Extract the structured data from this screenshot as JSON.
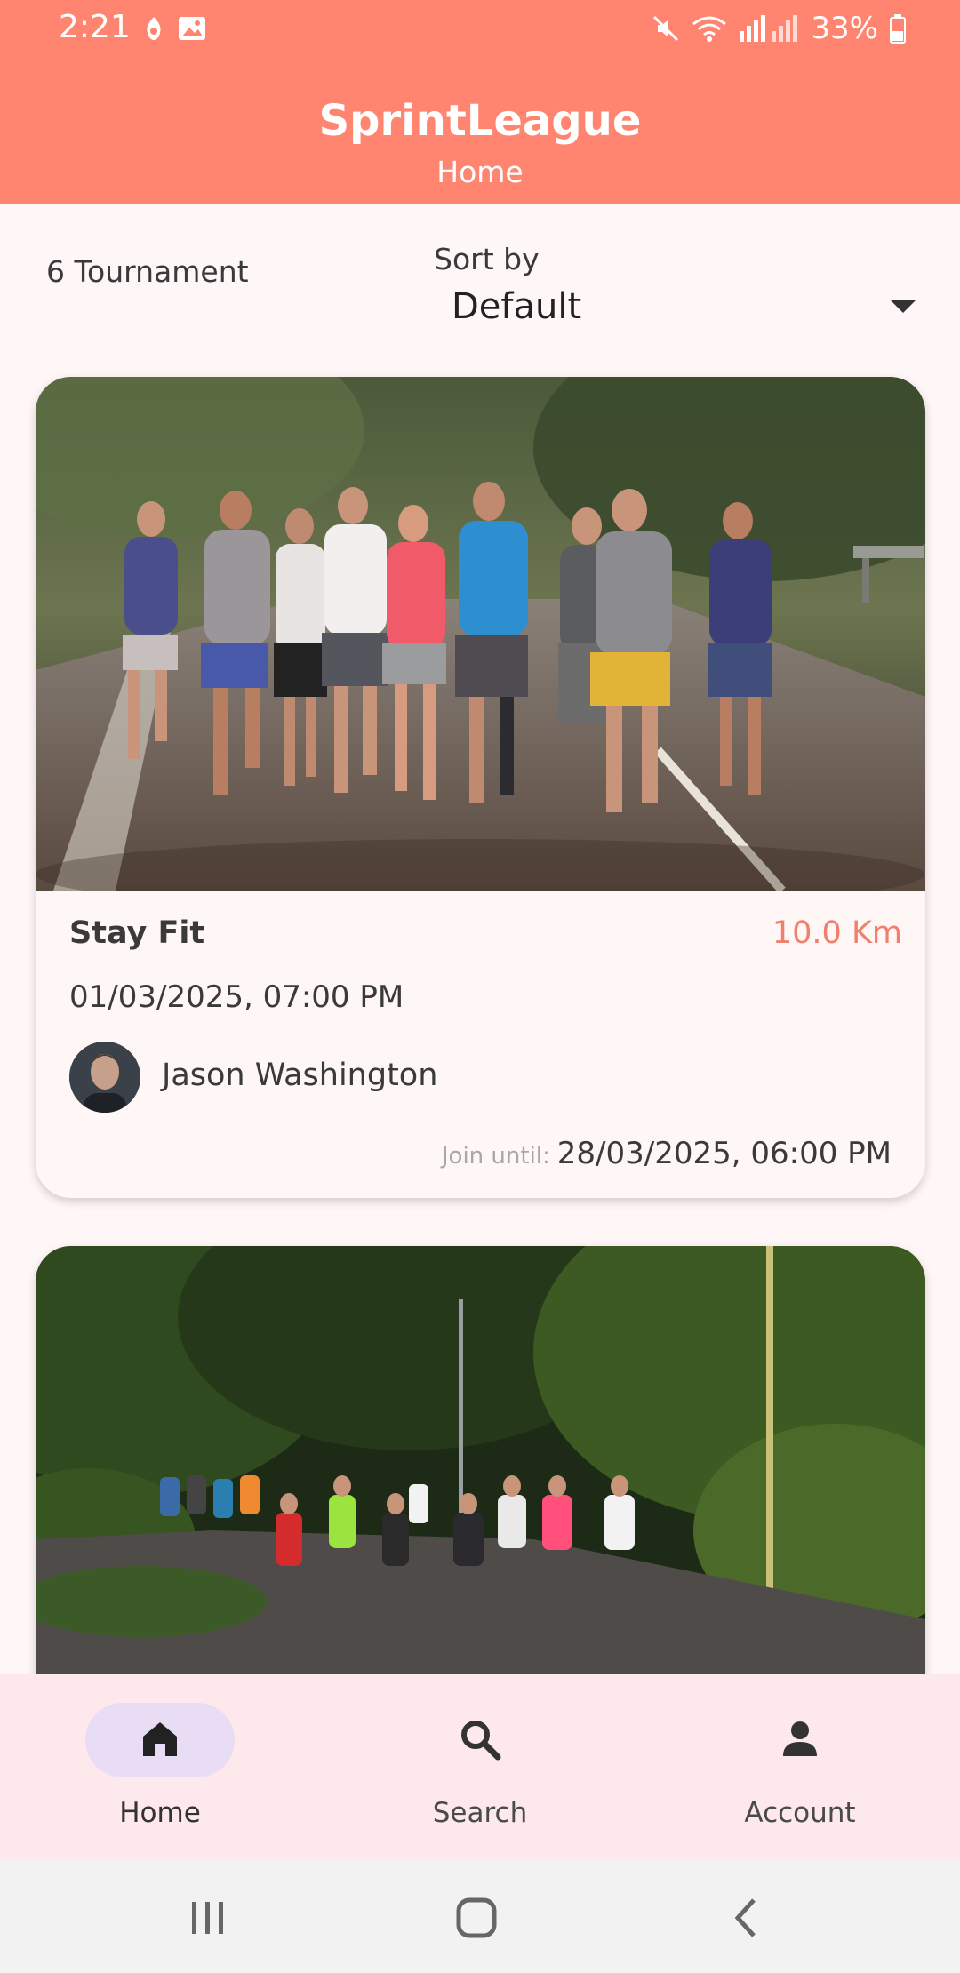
{
  "status_bar": {
    "time": "2:21",
    "battery_text": "33%",
    "icons": [
      "notification-icon",
      "image-icon",
      "mute-icon",
      "wifi-icon",
      "signal-icon",
      "battery-icon"
    ]
  },
  "header": {
    "title": "SprintLeague",
    "subtitle": "Home",
    "background_color": "#ff8570"
  },
  "filter": {
    "count_text": "6 Tournament",
    "sort_label": "Sort by",
    "sort_value": "Default"
  },
  "tournaments": [
    {
      "name": "Stay Fit",
      "distance": "10.0 Km",
      "date": "01/03/2025, 07:00 PM",
      "organizer": "Jason Washington",
      "join_label": "Join until:",
      "join_date": "28/03/2025, 06:00 PM"
    },
    {
      "name": "",
      "distance": "",
      "date": "",
      "organizer": "",
      "join_label": "",
      "join_date": ""
    }
  ],
  "bottom_nav": {
    "items": [
      {
        "label": "Home",
        "icon": "home-icon",
        "active": true
      },
      {
        "label": "Search",
        "icon": "search-icon",
        "active": false
      },
      {
        "label": "Account",
        "icon": "person-icon",
        "active": false
      }
    ]
  },
  "system_nav": {
    "buttons": [
      "recents-icon",
      "home-circle-icon",
      "back-icon"
    ]
  },
  "colors": {
    "accent": "#ff8570",
    "distance": "#f0806c",
    "nav_background": "#fde8ec",
    "nav_active_pill": "#e9dcf5"
  }
}
